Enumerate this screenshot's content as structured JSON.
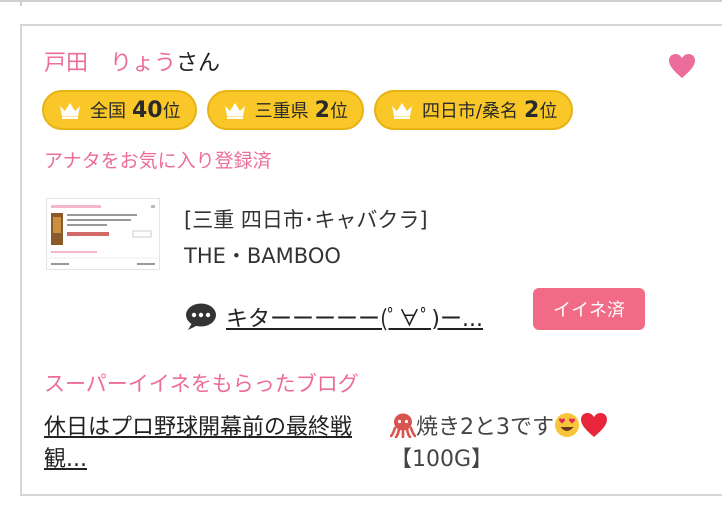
{
  "user": {
    "name": "戸田　りょう",
    "honorific": "さん"
  },
  "rankings": [
    {
      "scope": "全国",
      "rank": "40",
      "unit": "位"
    },
    {
      "scope": "三重県",
      "rank": "2",
      "unit": "位"
    },
    {
      "scope": "四日市/桑名",
      "rank": "2",
      "unit": "位"
    }
  ],
  "favorite_note": "アナタをお気に入り登録済",
  "shop": {
    "area": "[三重 四日市･キャバクラ]",
    "name": "THE・BAMBOO"
  },
  "message": {
    "text": "キターーーーー(ﾟ∀ﾟ)ー...",
    "badge": "イイネ済"
  },
  "blog": {
    "heading": "スーパーイイネをもらったブログ",
    "title": "休日はプロ野球開幕前の最終戦観...",
    "extra_text_1": "焼き2と3です",
    "extra_text_2": "【100G】"
  },
  "colors": {
    "accent_pink": "#ec6c9a",
    "badge_yellow": "#f9c828",
    "iine_badge": "#f26b86"
  }
}
